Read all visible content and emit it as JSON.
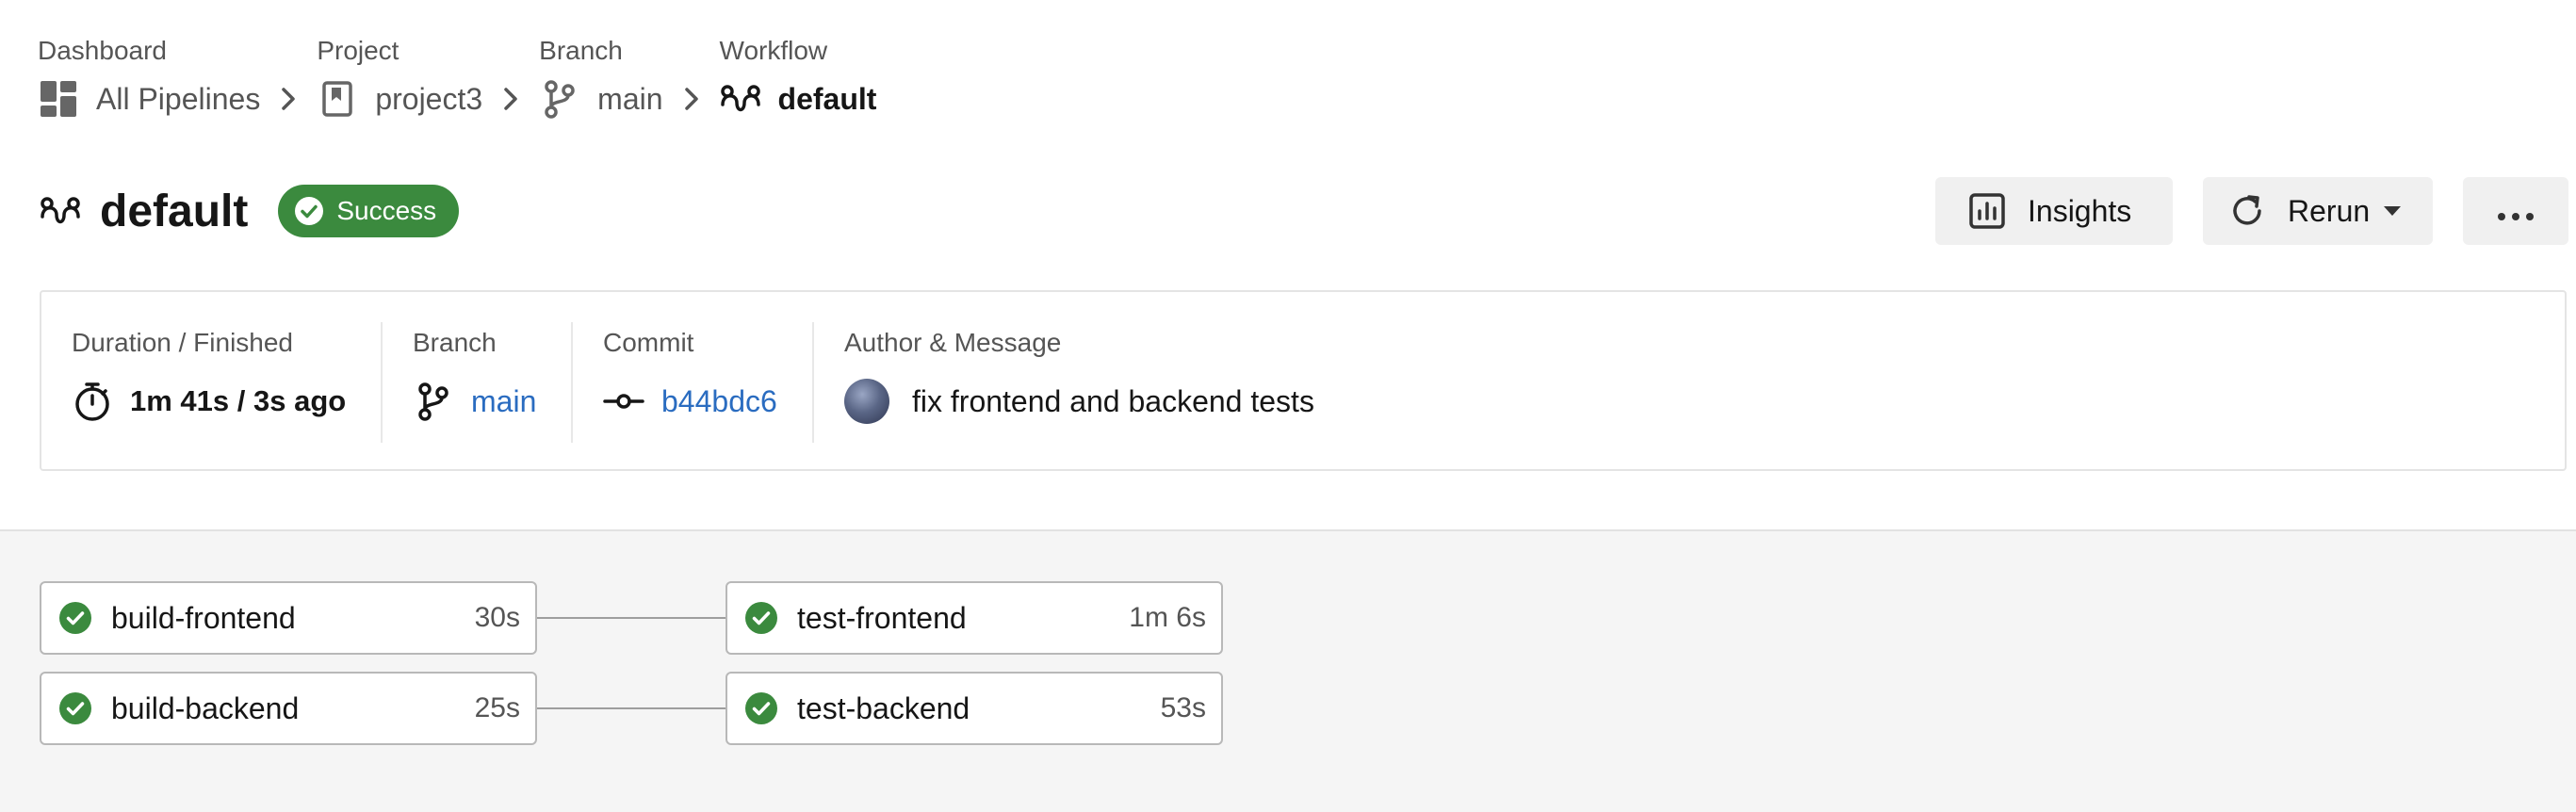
{
  "breadcrumb": {
    "dashboard": {
      "category": "Dashboard",
      "label": "All Pipelines"
    },
    "project": {
      "category": "Project",
      "label": "project3"
    },
    "branch": {
      "category": "Branch",
      "label": "main"
    },
    "workflow": {
      "category": "Workflow",
      "label": "default"
    }
  },
  "header": {
    "title": "default",
    "status": "Success",
    "status_color": "#3b8a3e",
    "insights_label": "Insights",
    "rerun_label": "Rerun"
  },
  "summary": {
    "duration": {
      "label": "Duration / Finished",
      "value": "1m 41s / 3s ago"
    },
    "branch": {
      "label": "Branch",
      "value": "main"
    },
    "commit": {
      "label": "Commit",
      "value": "b44bdc6"
    },
    "author": {
      "label": "Author & Message",
      "message": "fix frontend and backend tests"
    },
    "link_color": "#2a6cc0"
  },
  "jobs": [
    {
      "name": "build-frontend",
      "duration": "30s",
      "status": "success"
    },
    {
      "name": "build-backend",
      "duration": "25s",
      "status": "success"
    },
    {
      "name": "test-frontend",
      "duration": "1m 6s",
      "status": "success"
    },
    {
      "name": "test-backend",
      "duration": "53s",
      "status": "success"
    }
  ]
}
